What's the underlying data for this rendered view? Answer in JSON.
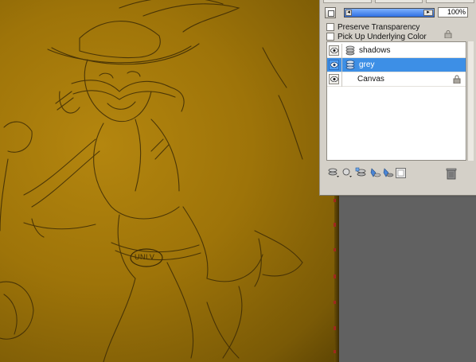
{
  "panel": {
    "opacity_value": "100%",
    "preserve_transparency_label": "Preserve Transparency",
    "pick_up_underlying_label": "Pick Up Underlying Color",
    "layers": [
      {
        "name": "shadows",
        "selected": false,
        "type": "layer"
      },
      {
        "name": "grey",
        "selected": true,
        "type": "layer"
      },
      {
        "name": "Canvas",
        "selected": false,
        "type": "canvas"
      }
    ]
  },
  "canvas": {
    "badge_text": "UNLV"
  },
  "colors": {
    "selection": "#3d8fe6",
    "panel_bg": "#d4d0c8",
    "paper": "#9e7409",
    "workspace": "#616161"
  },
  "icons": [
    "eye-icon",
    "layer-stack-icon",
    "lock-icon",
    "trash-icon",
    "new-layer-icon",
    "new-group-icon",
    "mask-icon"
  ]
}
